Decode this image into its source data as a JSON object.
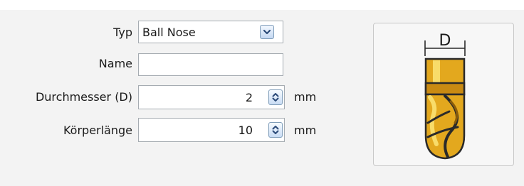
{
  "form": {
    "type": {
      "label": "Typ",
      "value": "Ball Nose"
    },
    "name": {
      "label": "Name",
      "value": ""
    },
    "diameter": {
      "label": "Durchmesser (D)",
      "value": "2",
      "unit": "mm"
    },
    "body_length": {
      "label": "Körperlänge",
      "value": "10",
      "unit": "mm"
    }
  },
  "preview": {
    "dimension_label": "D",
    "icon": "ball-nose-end-mill-icon"
  },
  "colors": {
    "panel_background": "#f3f3f3",
    "field_border": "#a6acb2",
    "button_border": "#7f9db9",
    "tool_gold": "#e3a81e",
    "tool_highlight": "#f8dc6a",
    "tool_outline": "#2a2a2a"
  }
}
